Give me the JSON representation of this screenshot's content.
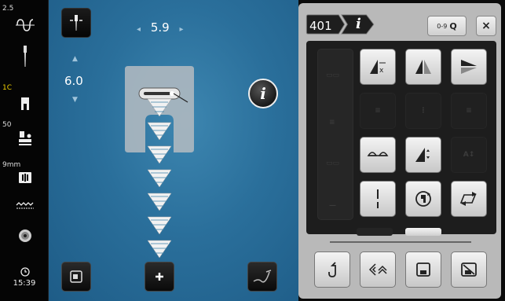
{
  "status_bar": {
    "needle_size": "2.5",
    "thread_label": "1C",
    "feed_label": "50",
    "feed_dog": "9mm",
    "clock": "15:39"
  },
  "sewing": {
    "stitch_width": "5.9",
    "stitch_length": "6.0",
    "info_label": "i"
  },
  "panel": {
    "stitch_number": "401",
    "info_tab_label": "i",
    "search_range": "0-9",
    "search_icon": "Q",
    "close_label": "×"
  },
  "icons": {
    "needle_position": "needle-position-icon",
    "thread_tension": "thread-tension-icon",
    "presser_foot": "presser-foot-icon",
    "stitch_plate": "stitch-plate-icon",
    "bobbin": "bobbin-icon",
    "clock": "clock-icon"
  },
  "colors": {
    "accent_yellow": "#f0d000",
    "sewing_bg": "#2a6f9b",
    "panel_bg": "#b9b9b9"
  }
}
